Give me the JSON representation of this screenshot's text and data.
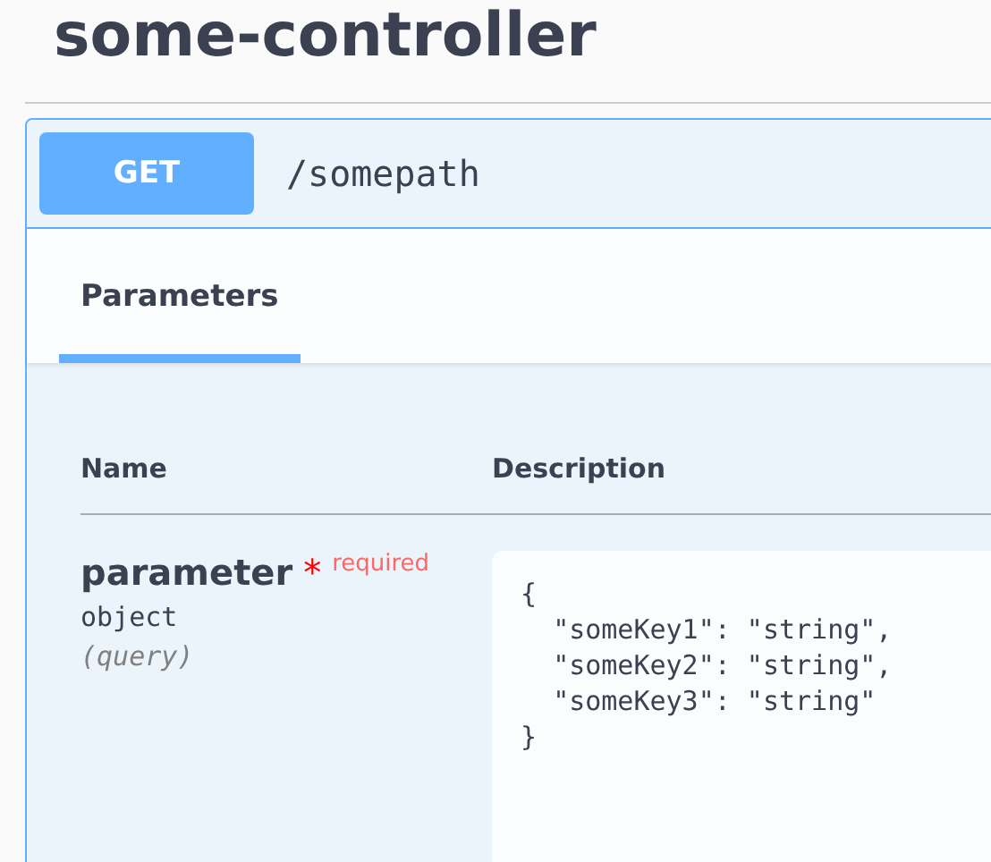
{
  "section_title": "some-controller",
  "operation": {
    "method": "GET",
    "path": "/somepath"
  },
  "tabs": [
    {
      "label": "Parameters",
      "selected": true
    }
  ],
  "table": {
    "columns": [
      "Name",
      "Description"
    ],
    "rows": [
      {
        "name": "parameter",
        "required": true,
        "required_mark": "*",
        "required_label": "required",
        "type": "object",
        "location": "(query)",
        "value": "{\n  \"someKey1\": \"string\",\n  \"someKey2\": \"string\",\n  \"someKey3\": \"string\"\n}"
      }
    ]
  }
}
